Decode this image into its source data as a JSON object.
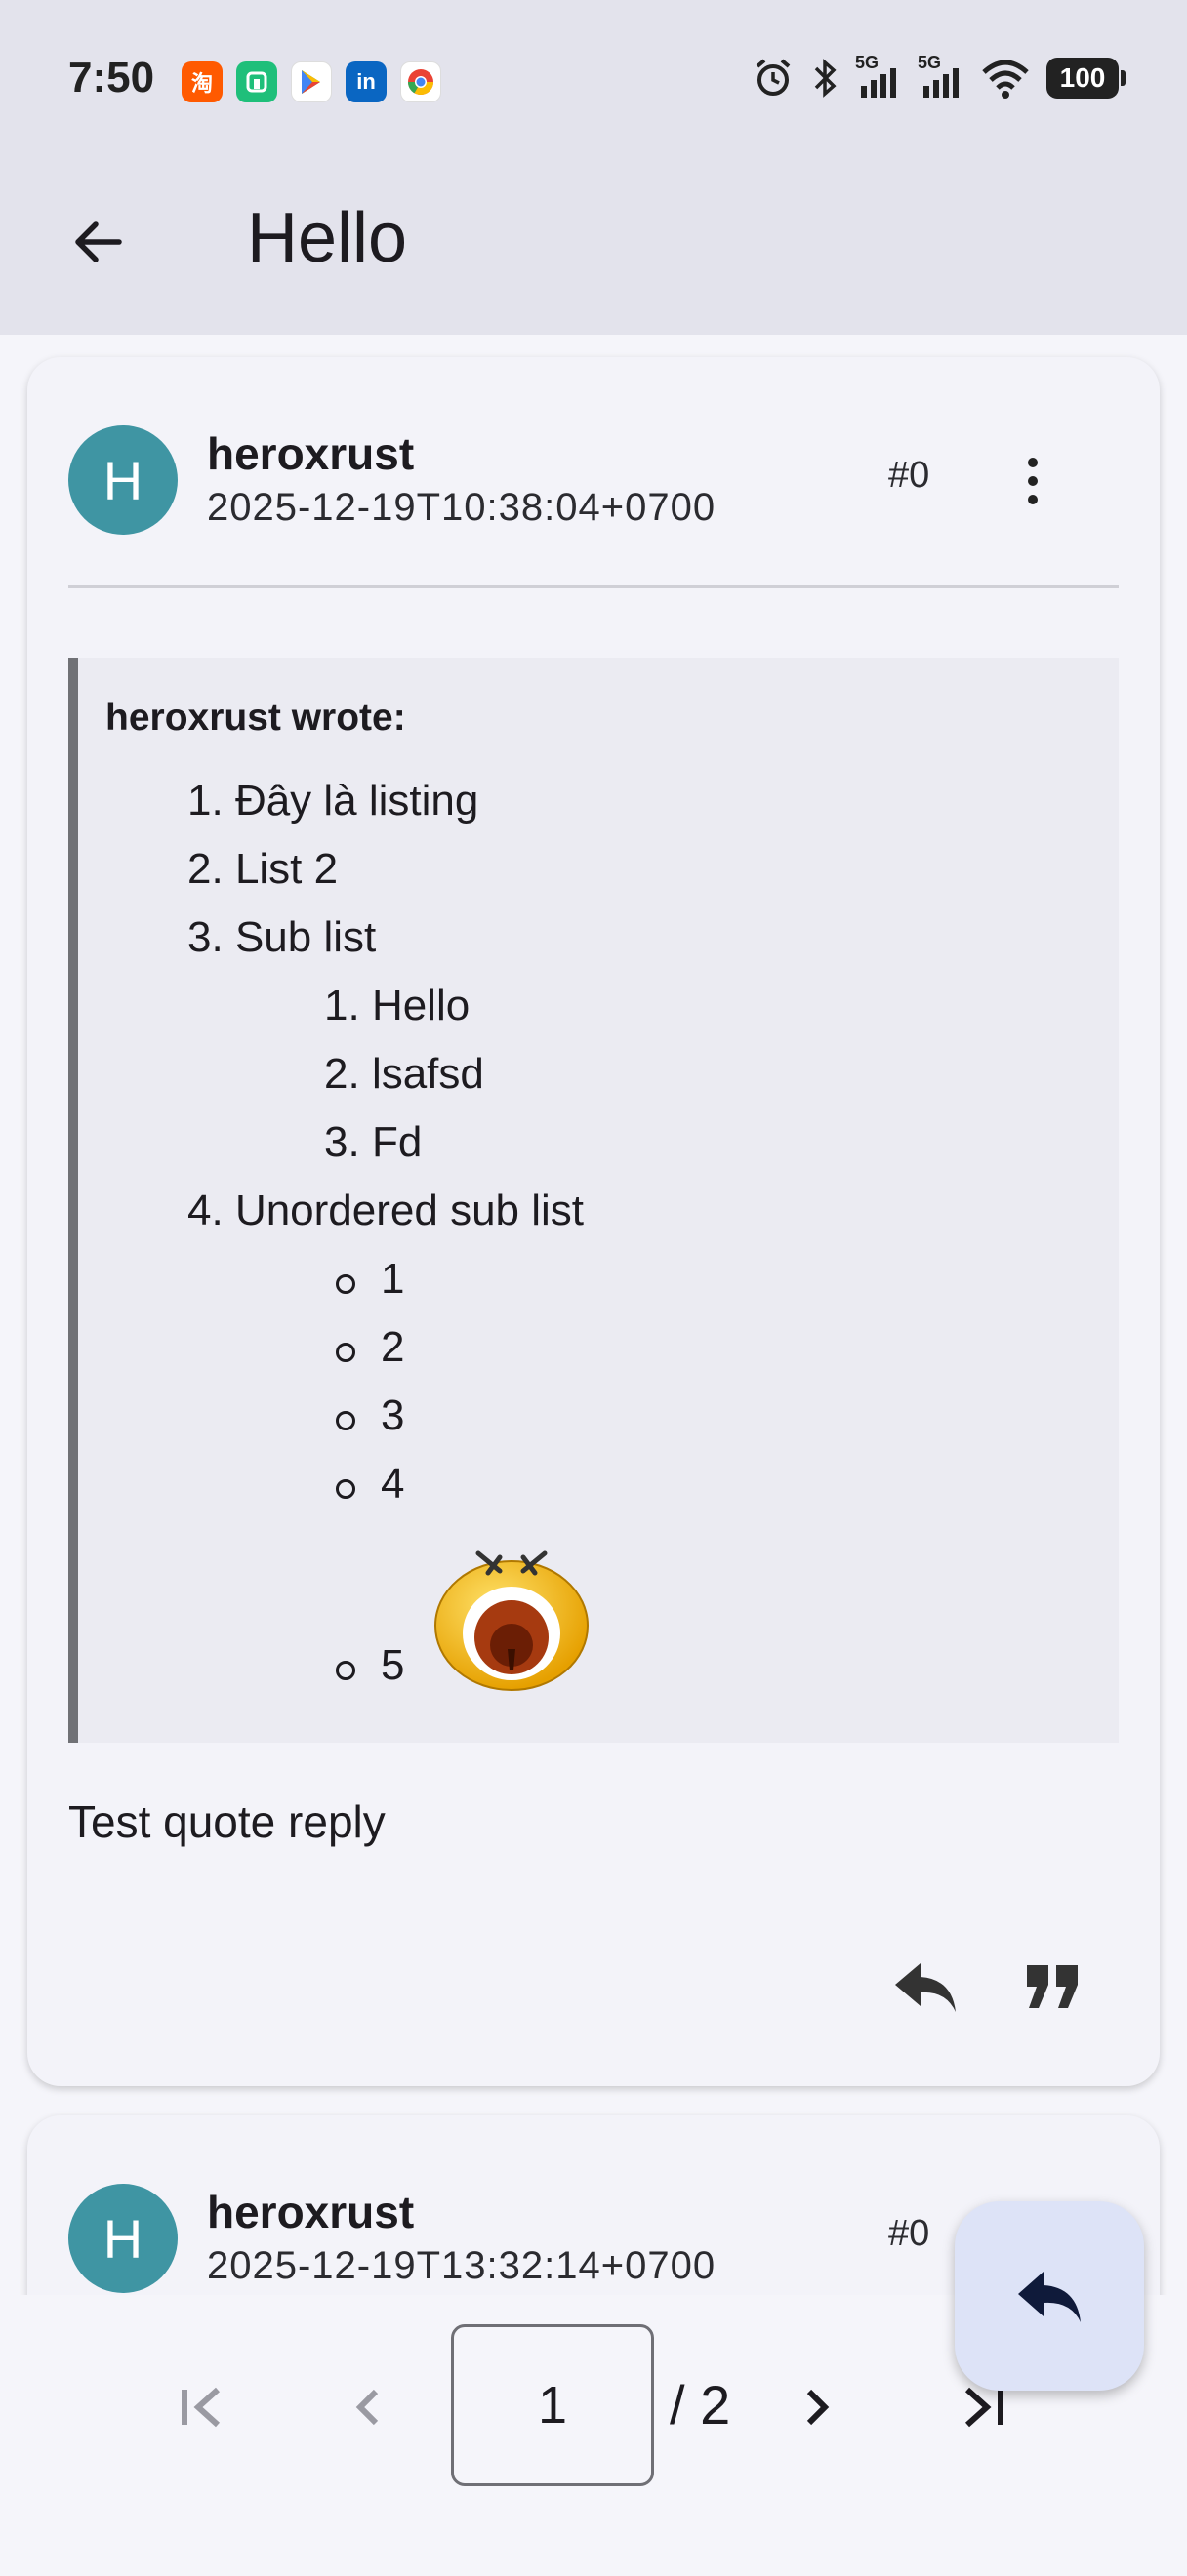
{
  "status_bar": {
    "time": "7:50",
    "app_icons": [
      {
        "name": "taobao-icon",
        "glyph": "淘",
        "color": "#ff5a00"
      },
      {
        "name": "mi-home-icon",
        "glyph": "◫",
        "color": "#1fbf7a"
      },
      {
        "name": "play-store-icon",
        "glyph": "▶",
        "color": "#ffffff"
      },
      {
        "name": "linkedin-icon",
        "glyph": "in",
        "color": "#0a66c2"
      },
      {
        "name": "chrome-icon",
        "glyph": "◉",
        "color": "#ffffff"
      }
    ],
    "battery": "100",
    "network_1": "5G",
    "network_2": "5G"
  },
  "app_bar": {
    "title": "Hello"
  },
  "posts": [
    {
      "avatar_letter": "H",
      "username": "heroxrust",
      "timestamp": "2025-12-19T10:38:04+0700",
      "post_number": "#0",
      "quote": {
        "header": "heroxrust wrote:",
        "items": [
          {
            "num": "1.",
            "text": "Đây là listing"
          },
          {
            "num": "2.",
            "text": "List 2"
          },
          {
            "num": "3.",
            "text": "Sub list"
          },
          {
            "num": "1.",
            "text": "Hello"
          },
          {
            "num": "2.",
            "text": "lsafsd"
          },
          {
            "num": "3.",
            "text": "Fd"
          },
          {
            "num": "4.",
            "text": "Unordered sub list"
          },
          {
            "num": "",
            "text": "1"
          },
          {
            "num": "",
            "text": "2"
          },
          {
            "num": "",
            "text": "3"
          },
          {
            "num": "",
            "text": "4"
          },
          {
            "num": "",
            "text": "5"
          }
        ]
      },
      "body": "Test quote reply"
    },
    {
      "avatar_letter": "H",
      "username": "heroxrust",
      "timestamp": "2025-12-19T13:32:14+0700",
      "post_number": "#0"
    }
  ],
  "pagination": {
    "current_page": "1",
    "total_label": "/ 2"
  },
  "colors": {
    "avatar": "#3f95a3",
    "app_bar": "#e3e3ec",
    "card": "#f3f3f9",
    "quote_bg": "#ebebf2",
    "fab": "#dde3f7"
  }
}
